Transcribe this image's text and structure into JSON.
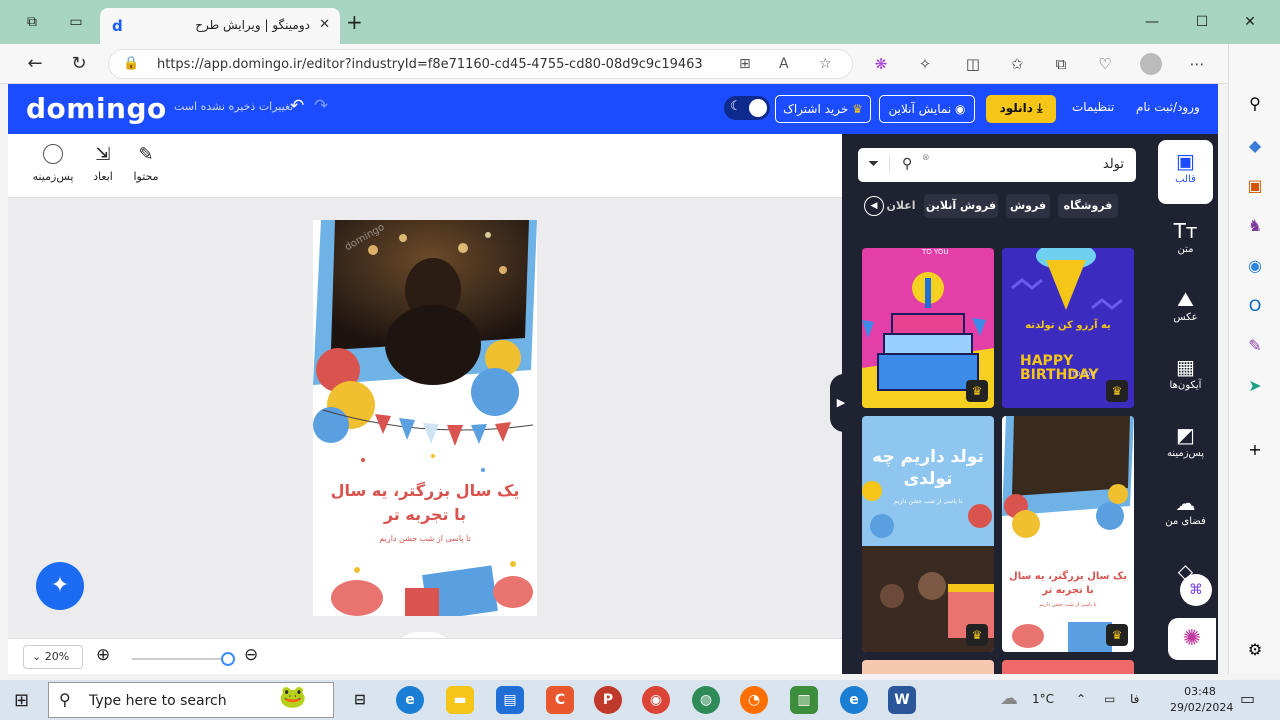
{
  "browser": {
    "tab_title": "دومینگو | ویرایش طرح",
    "url": "https://app.domingo.ir/editor?industryId=f8e71160-cd45-4755-cd80-08d9c9c19463"
  },
  "app": {
    "logo": "domingo",
    "save_status": "تغییرات ذخیره نشده است",
    "buy_subscription": "خرید اشتراک",
    "online_preview": "نمایش آنلاین",
    "download": "دانلود",
    "settings": "تنظیمات",
    "login": "ورود/ثبت نام"
  },
  "toolbar": {
    "content": "محتوا",
    "dimensions": "ابعاد",
    "background": "پس‌زمینه"
  },
  "design": {
    "headline_1": "یک سال بزرگتر، یه سال",
    "headline_2": "با تجربه تر",
    "subline": "تا پاسی از شب جشن داریم",
    "watermark": "domingo"
  },
  "zoom": {
    "level": "20%"
  },
  "panel": {
    "search_value": "تولد",
    "chips": [
      "فروشگاه",
      "فروش",
      "فروش آنلاین",
      "اعلان"
    ],
    "thumbs": {
      "t1_text": "TO YOU",
      "t2_text_fa": "یه آرزو کن تولدته",
      "t2_text_en": "HAPPY BIRTHDAY",
      "t2_sub": "TO YOU",
      "t3_title": "تولد داریم چه تولدی",
      "t3_sub": "تا پاسی از شب جشن داریم",
      "t4_title": "یک سال بزرگتر، یه سال با تجربه تر",
      "t4_sub": "تا پاسی از شب جشن داریم"
    }
  },
  "sidenav": [
    {
      "label": "قالب",
      "icon": "template-icon"
    },
    {
      "label": "متن",
      "icon": "text-icon"
    },
    {
      "label": "عکس",
      "icon": "image-icon"
    },
    {
      "label": "آیکون‌ها",
      "icon": "icons-grid-icon"
    },
    {
      "label": "پس‌زمینه",
      "icon": "background-icon"
    },
    {
      "label": "فضای من",
      "icon": "upload-cloud-icon"
    },
    {
      "label": "",
      "icon": "diamond-icon"
    }
  ],
  "taskbar": {
    "search_placeholder": "Type here to search",
    "temperature": "1°C",
    "lang": "فا",
    "time": "03:48",
    "date": "29/02/2024"
  },
  "colors": {
    "brand_blue": "#1c4cff",
    "panel_dark": "#1f2230",
    "download_yellow": "#f5c518"
  }
}
